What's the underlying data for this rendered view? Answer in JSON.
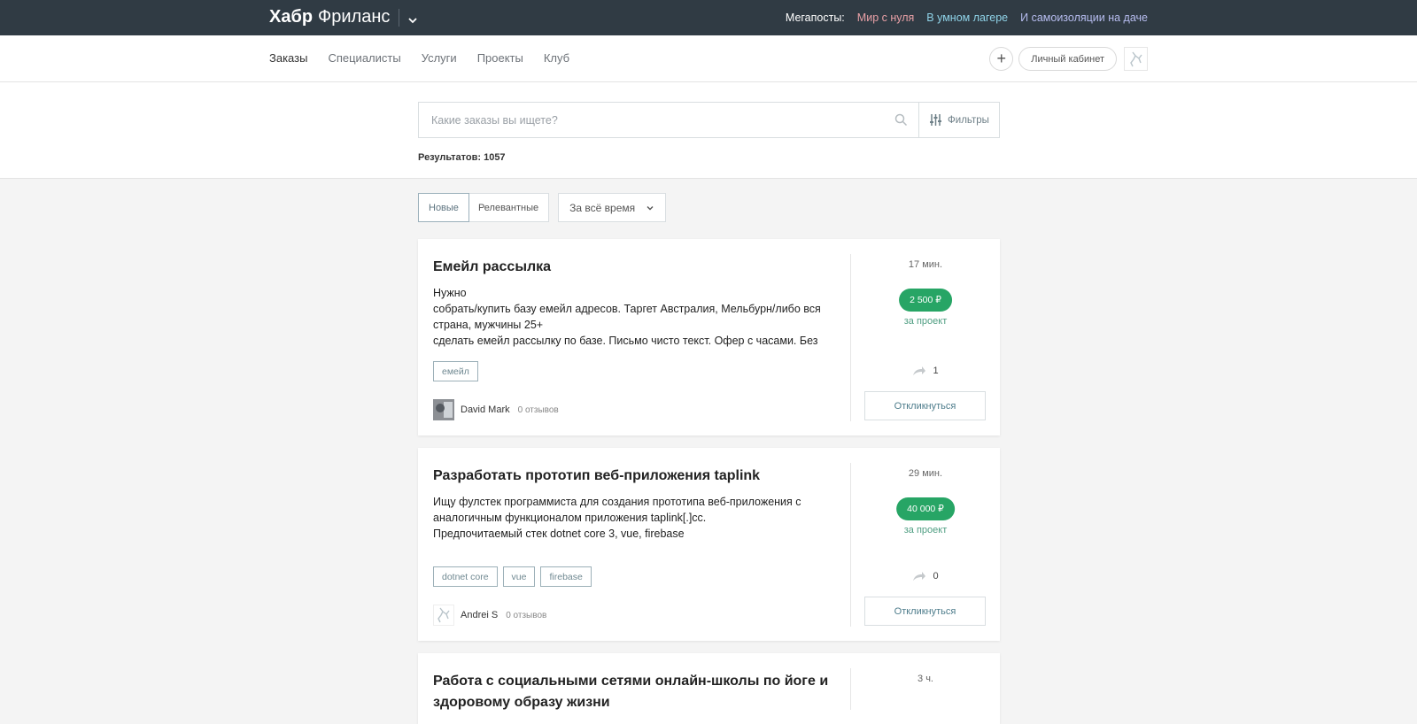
{
  "header": {
    "logo_bold": "Хабр",
    "logo_light": "Фриланс",
    "megaposts_label": "Мегапосты:",
    "megaposts": [
      "Мир с нуля",
      "В умном лагере",
      "И самоизоляции на даче"
    ]
  },
  "nav": {
    "tabs": [
      "Заказы",
      "Специалисты",
      "Услуги",
      "Проекты",
      "Клуб"
    ],
    "cabinet": "Личный кабинет",
    "plus": "+"
  },
  "search": {
    "placeholder": "Какие заказы вы ищете?",
    "filters": "Фильтры",
    "results": "Результатов: 1057"
  },
  "sort": {
    "new": "Новые",
    "relevant": "Релевантные",
    "period": "За всё время"
  },
  "tasks": [
    {
      "title": "Емейл рассылка",
      "description": "Нужно\nсобрать/купить базу емейл адресов. Таргет Австралия, Мельбурн/либо вся страна, мужчины 25+\nсделать емейл рассылку по базе. Письмо чисто текст. Офер с часами. Без",
      "tags": [
        "емейл"
      ],
      "author": "David Mark",
      "reviews": "0 отзывов",
      "time": "17 мин.",
      "price": "2 500 ₽",
      "price_unit": "за проект",
      "responses": "1",
      "respond": "Откликнуться"
    },
    {
      "title": "Разработать прототип веб-приложения taplink",
      "description": "Ищу фулстек программиста для создания прототипа веб-приложения с аналогичным функционалом приложения taplink[.]cc.\nПредпочитаемый стек dotnet core 3, vue, firebase",
      "tags": [
        "dotnet core",
        "vue",
        "firebase"
      ],
      "author": "Andrei S",
      "reviews": "0 отзывов",
      "time": "29 мин.",
      "price": "40 000 ₽",
      "price_unit": "за проект",
      "responses": "0",
      "respond": "Откликнуться"
    },
    {
      "title": "Работа с социальными сетями онлайн-школы по йоге и здоровому образу жизни",
      "time": "3 ч."
    }
  ],
  "colors": {
    "topbar": "#303b44",
    "price_badge": "#27a565",
    "accent": "#4d7c8b"
  }
}
